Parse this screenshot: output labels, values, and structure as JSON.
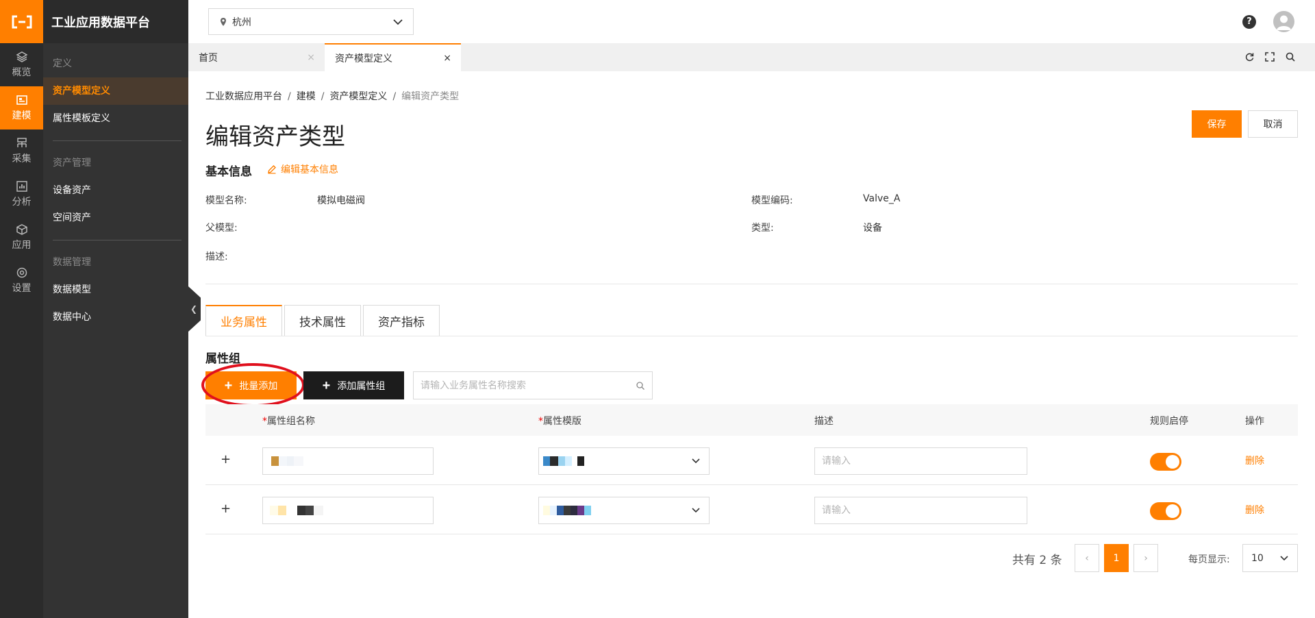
{
  "app": {
    "title": "工业应用数据平台"
  },
  "rail": [
    {
      "label": "概览",
      "icon": "layers-icon"
    },
    {
      "label": "建模",
      "icon": "model-icon",
      "active": true
    },
    {
      "label": "采集",
      "icon": "collect-icon"
    },
    {
      "label": "分析",
      "icon": "chart-icon"
    },
    {
      "label": "应用",
      "icon": "cube-icon"
    },
    {
      "label": "设置",
      "icon": "settings-icon"
    }
  ],
  "menu": {
    "group1": "定义",
    "item_asset_model": "资产模型定义",
    "item_attr_template": "属性模板定义",
    "group2": "资产管理",
    "item_device_asset": "设备资产",
    "item_space_asset": "空间资产",
    "group3": "数据管理",
    "item_data_model": "数据模型",
    "item_data_center": "数据中心"
  },
  "topbar": {
    "city": "杭州",
    "help": "?"
  },
  "page_tabs": [
    {
      "label": "首页",
      "close": "×"
    },
    {
      "label": "资产模型定义",
      "close": "×",
      "active": true
    }
  ],
  "breadcrumb": [
    "工业数据应用平台",
    "建模",
    "资产模型定义",
    "编辑资产类型"
  ],
  "breadcrumb_sep": "/",
  "page_title": "编辑资产类型",
  "buttons": {
    "save": "保存",
    "cancel": "取消"
  },
  "basic_info": {
    "title": "基本信息",
    "edit_link": "编辑基本信息",
    "model_name_label": "模型名称:",
    "model_name_value": "模拟电磁阀",
    "model_code_label": "模型编码:",
    "model_code_value": "Valve_A",
    "parent_label": "父模型:",
    "parent_value": "",
    "type_label": "类型:",
    "type_value": "设备",
    "desc_label": "描述:",
    "desc_value": ""
  },
  "content_tabs": [
    "业务属性",
    "技术属性",
    "资产指标"
  ],
  "attr_group": {
    "title": "属性组",
    "batch_add": "批量添加",
    "add_group": "添加属性组",
    "search_placeholder": "请输入业务属性名称搜索"
  },
  "table": {
    "headers": {
      "group_name": "属性组名称",
      "template": "属性模版",
      "desc": "描述",
      "rule": "规则启停",
      "ops": "操作"
    },
    "required_mark": "*",
    "rows": [
      {
        "expand": "+",
        "desc_placeholder": "请输入",
        "rule_on": true,
        "op": "删除"
      },
      {
        "expand": "+",
        "desc_placeholder": "请输入",
        "rule_on": true,
        "op": "删除"
      }
    ]
  },
  "pagination": {
    "total": "共有 2 条",
    "current": "1",
    "prev": "‹",
    "next": "›",
    "per_page_label": "每页显示:",
    "per_page": "10"
  },
  "colors": {
    "accent": "#ff7f00",
    "sidebar": "#333333",
    "rail": "#2b2b2b",
    "annotation": "#e0101d"
  }
}
